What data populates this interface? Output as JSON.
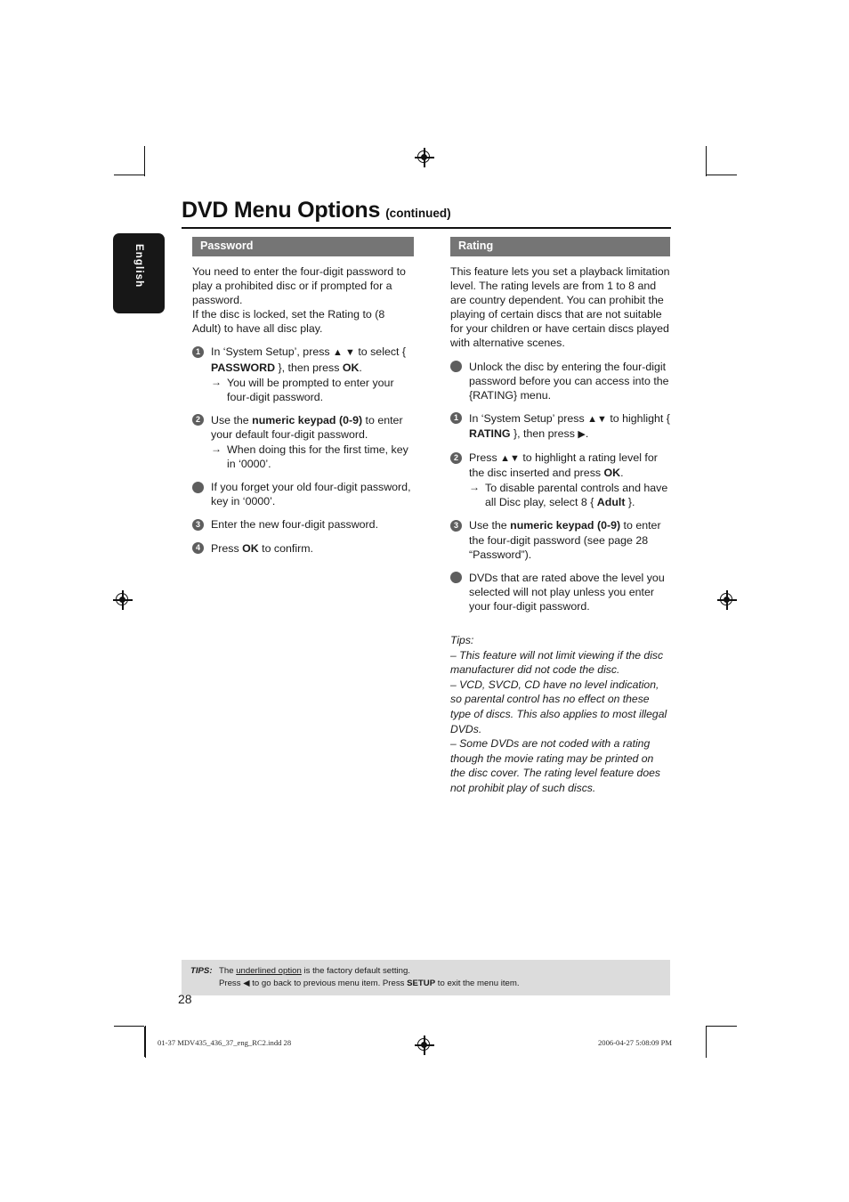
{
  "document": {
    "title_main": "DVD Menu Options",
    "title_continued": "(continued)",
    "language_tab": "English",
    "page_number": "28"
  },
  "left_column": {
    "heading": "Password",
    "intro_1": "You need to enter the four-digit password to play a prohibited disc or if prompted for a password.",
    "intro_2": "If the disc is locked, set the Rating to (8 Adult) to have all disc play.",
    "steps": [
      {
        "marker": "1",
        "marker_type": "number",
        "text_before": "In ‘System Setup’, press ",
        "arrows": "▲ ▼",
        "text_mid": " to select { ",
        "bold_1": "PASSWORD",
        "text_after": " }, then press ",
        "bold_2": "OK",
        "text_end": ".",
        "sub": "You will be prompted to enter your four-digit password."
      },
      {
        "marker": "2",
        "marker_type": "number",
        "text_before": "Use the ",
        "bold_1": "numeric keypad (0-9)",
        "text_after": " to enter your default four-digit password.",
        "sub": "When doing this for the first time, key in ‘0000’."
      },
      {
        "marker": "•",
        "marker_type": "bullet",
        "text_before": "If you forget your old four-digit password, key in ‘0000’."
      },
      {
        "marker": "3",
        "marker_type": "number",
        "text_before": "Enter the new four-digit password."
      },
      {
        "marker": "4",
        "marker_type": "number",
        "text_before": "Press ",
        "bold_1": "OK",
        "text_after": " to confirm."
      }
    ]
  },
  "right_column": {
    "heading": "Rating",
    "intro_1": "This feature lets you set a playback limitation level. The rating levels are from 1 to 8 and are country dependent. You can prohibit the playing of certain discs that are not suitable for your children or have certain discs played with alternative scenes.",
    "bullet_1": "Unlock the disc by entering the four-digit password before you can access into the {RATING} menu.",
    "steps": [
      {
        "marker": "1",
        "marker_type": "number",
        "text_before": "In ‘System Setup’ press ",
        "arrows": "▲▼",
        "text_mid": " to highlight { ",
        "bold_1": "RATING",
        "text_after": " }, then press ",
        "arrow_right": "▶",
        "text_end": "."
      },
      {
        "marker": "2",
        "marker_type": "number",
        "text_before": "Press ",
        "arrows": "▲▼",
        "text_mid": " to highlight a rating level for the disc inserted and press ",
        "bold_1": "OK",
        "text_end": ".",
        "sub_before": "To disable parental controls and have all Disc play, select 8 { ",
        "sub_bold": "Adult",
        "sub_after": " }."
      },
      {
        "marker": "3",
        "marker_type": "number",
        "text_before": "Use the ",
        "bold_1": "numeric keypad (0-9)",
        "text_after": " to enter the four-digit password (see page 28 “Password”)."
      },
      {
        "marker": "•",
        "marker_type": "bullet",
        "text_before": "DVDs that are rated above the level you selected will not play unless you enter your four-digit password."
      }
    ],
    "tips": {
      "label": "Tips:",
      "lines": [
        "– This feature will not limit viewing if the disc manufacturer did not code the disc.",
        "– VCD, SVCD, CD have no level indication, so parental control has no effect on these type of discs. This also applies to most illegal DVDs.",
        "– Some DVDs are not coded with a rating though the movie rating may be printed on the disc cover. The rating level feature does not prohibit play of such discs."
      ]
    }
  },
  "footer_tips": {
    "label": "TIPS:",
    "line1_pre": "The ",
    "line1_underlined": "underlined option",
    "line1_post": " is the factory default setting.",
    "line2_pre": "Press ",
    "line2_arrow": "◀",
    "line2_mid": " to go back to previous menu item. Press ",
    "line2_bold": "SETUP",
    "line2_post": " to exit the menu item."
  },
  "print_slug": {
    "left": "01-37 MDV435_436_37_eng_RC2.indd   28",
    "right": "2006-04-27   5:08:09 PM"
  },
  "colors": {
    "section_bar": "#757575",
    "marker": "#5e5e5e",
    "footer_bar": "#dcdcdc",
    "lang_tab": "#171717"
  }
}
